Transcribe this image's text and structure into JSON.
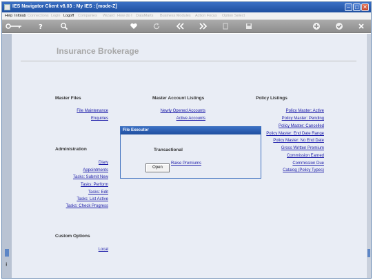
{
  "window": {
    "title": "IES Navigator Client v8.03 : My IES :    [mode-Z]",
    "min": "–",
    "max": "□",
    "close": "✕"
  },
  "menu": [
    {
      "label": "Help",
      "enabled": true
    },
    {
      "label": "Infolab",
      "enabled": true
    },
    {
      "label": "Connections",
      "enabled": false
    },
    {
      "label": "Login",
      "enabled": false
    },
    {
      "label": "Logoff",
      "enabled": true
    },
    {
      "label": "Companies",
      "enabled": false
    },
    {
      "label": "Wizard",
      "enabled": false
    },
    {
      "label": "How do I",
      "enabled": false
    },
    {
      "label": "DataMarts",
      "enabled": false
    },
    {
      "label": "Business Modules",
      "enabled": false
    },
    {
      "label": "Action Focus",
      "enabled": false
    },
    {
      "label": "Option Select",
      "enabled": false
    }
  ],
  "toolbar": {
    "icons": [
      "key-icon",
      "help-icon",
      "search-icon",
      "heart-icon",
      "refresh-icon",
      "back-icon",
      "forward-icon",
      "copy-icon",
      "save-icon",
      "plus-icon",
      "check-icon",
      "close-icon"
    ]
  },
  "page": {
    "heading": "Insurance Brokerage"
  },
  "sections": {
    "master_files": {
      "title": "Master Files",
      "links": [
        "File Maintenance",
        "Enquiries"
      ]
    },
    "master_account_listings": {
      "title": "Master Account Listings",
      "links": [
        "Newly Opened Accounts",
        "Active Accounts"
      ]
    },
    "policy_listings": {
      "title": "Policy Listings",
      "links": [
        "Policy Master: Active",
        "Policy Master: Pending",
        "Policy Master: Cancelled",
        "Policy Master: End Date Range",
        "Policy Master: No End Date",
        "Gross Written Premium",
        "Commission Earned",
        "Commission Due",
        "Catalog (Policy Types)"
      ]
    },
    "administration": {
      "title": "Administration",
      "links": [
        "Diary",
        "Appointments",
        "Tasks: Submit New",
        "Tasks: Perform",
        "Tasks: Edit",
        "Tasks: List Active",
        "Tasks: Check Progress"
      ]
    },
    "transactional": {
      "title": "Transactional",
      "links": [
        "Raise Premiums"
      ]
    },
    "custom_options": {
      "title": "Custom Options",
      "links": [
        "Local"
      ]
    }
  },
  "dialog": {
    "title": "File Executor",
    "button": "Open"
  },
  "colors": {
    "title_bar": "#1f4f9f",
    "content_bg": "#e9edf5",
    "link": "#1a1aa8",
    "heading": "#a7a7a7"
  }
}
